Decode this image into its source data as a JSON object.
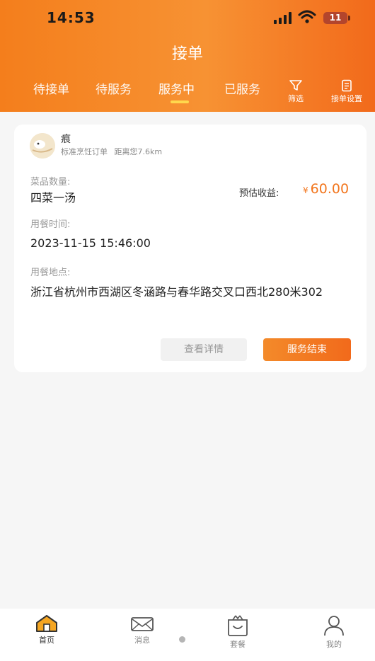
{
  "status_bar": {
    "time": "14:53",
    "battery": "11"
  },
  "header": {
    "title": "接单",
    "tabs": [
      {
        "label": "待接单",
        "active": false
      },
      {
        "label": "待服务",
        "active": false
      },
      {
        "label": "服务中",
        "active": true
      },
      {
        "label": "已服务",
        "active": false
      }
    ],
    "tools": {
      "filter_label": "筛选",
      "settings_label": "接单设置"
    }
  },
  "order": {
    "nickname": "痕",
    "order_type": "标准烹饪订单",
    "distance": "距离您7.6km",
    "dish_count_label": "菜品数量:",
    "dish_count_value": "四菜一汤",
    "income_label": "预估收益:",
    "income_currency": "¥",
    "income_value": "60.00",
    "time_label": "用餐时间:",
    "time_value": "2023-11-15 15:46:00",
    "location_label": "用餐地点:",
    "location_value": "浙江省杭州市西湖区冬涵路与春华路交叉口西北280米302",
    "detail_button": "查看详情",
    "finish_button": "服务结束"
  },
  "tabbar": {
    "items": [
      {
        "label": "首页",
        "icon": "home-icon",
        "active": true
      },
      {
        "label": "消息",
        "icon": "message-icon",
        "active": false
      },
      {
        "label": "套餐",
        "icon": "package-icon",
        "active": false
      },
      {
        "label": "我的",
        "icon": "profile-icon",
        "active": false
      }
    ]
  },
  "colors": {
    "accent": "#f47e1c",
    "income": "#f2761e",
    "tab_indicator": "#ffd84d"
  }
}
